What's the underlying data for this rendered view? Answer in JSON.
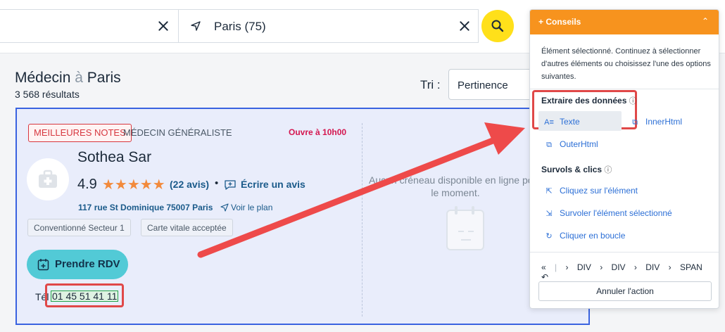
{
  "search": {
    "location_value": "Paris (75)"
  },
  "heading": {
    "title_prefix": "Médecin",
    "title_joiner": "à",
    "title_city": "Paris",
    "results_count": "3 568 résultats"
  },
  "sort": {
    "label": "Tri :",
    "selected": "Pertinence"
  },
  "result": {
    "badge": "MEILLEURES NOTES",
    "specialty": "MÉDECIN GÉNÉRALISTE",
    "open_status": "Ouvre à 10h00",
    "name": "Sothea Sar",
    "rating": "4.9",
    "stars": "★★★★★",
    "reviews_link": "(22 avis)",
    "dot": "•",
    "write_review": "Écrire un avis",
    "address": "117 rue St Dominique 75007 Paris",
    "map_link": "Voir le plan",
    "tags": [
      "Conventionné Secteur 1",
      "Carte vitale acceptée"
    ],
    "book_button": "Prendre RDV",
    "phone_label": "Tél :",
    "phone": "01 45 51 41 11",
    "no_slot_text": "Aucun créneau disponible en ligne pour le moment."
  },
  "panel": {
    "title": "+ Conseils",
    "collapse_icon": "⌃",
    "description": "Élément sélectionné. Continuez à sélectionner d'autres éléments ou choisissez l'une des options suivantes.",
    "extract_section": "Extraire des données",
    "extract_options": [
      "Texte",
      "InnerHtml",
      "OuterHtml"
    ],
    "hover_section": "Survols & clics",
    "hover_options": [
      "Cliquez sur l'élément",
      "Survoler l'élément sélectionné",
      "Cliquer en boucle"
    ],
    "breadcrumb": [
      "DIV",
      "DIV",
      "DIV",
      "SPAN"
    ],
    "cancel_button": "Annuler l'action"
  },
  "colors": {
    "accent_orange": "#f7931e",
    "link_blue": "#2c6fd6",
    "highlight_red": "#e04848",
    "search_yellow": "#ffe01a",
    "book_teal": "#52cad6"
  }
}
